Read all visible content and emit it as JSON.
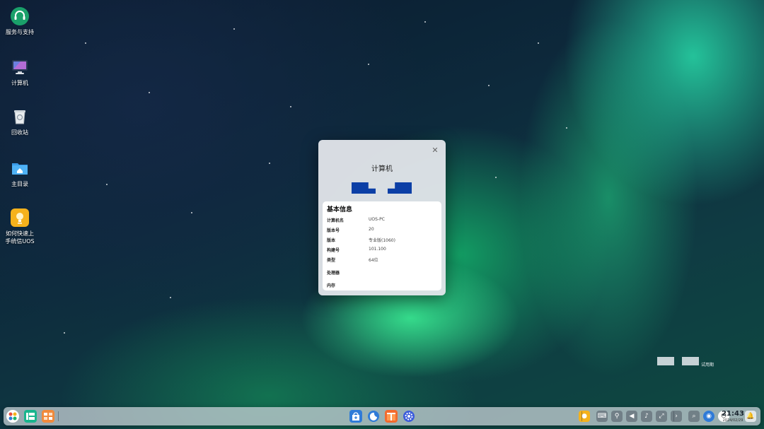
{
  "desktop": {
    "items": [
      {
        "label": "服务与支持",
        "icon": "headset-support-icon"
      },
      {
        "label": "计算机",
        "icon": "computer-monitor-icon"
      },
      {
        "label": "回收站",
        "icon": "trash-bin-icon"
      },
      {
        "label": "主目录",
        "icon": "home-folder-icon"
      },
      {
        "label": "如何快速上\n手统信UOS",
        "icon": "lightbulb-guide-icon"
      }
    ]
  },
  "dialog": {
    "title": "计算机",
    "close_glyph": "✕",
    "section_title": "基本信息",
    "rows": [
      {
        "key": "计算机名",
        "value": "UOS-PC"
      },
      {
        "key": "版本号",
        "value": "20"
      },
      {
        "key": "版本",
        "value": "专业版(1060)"
      },
      {
        "key": "构建号",
        "value": "101.100"
      },
      {
        "key": "类型",
        "value": "64位"
      },
      {
        "key": "处理器",
        "value": ""
      },
      {
        "key": "内存",
        "value": ""
      }
    ]
  },
  "watermark": {
    "text": "试用期"
  },
  "taskbar": {
    "clock_time": "21:43",
    "clock_date": "2024/02/29",
    "colors": {
      "accent": "#2f7bd8",
      "green": "#1db36b",
      "orange": "#f08a3c"
    }
  }
}
